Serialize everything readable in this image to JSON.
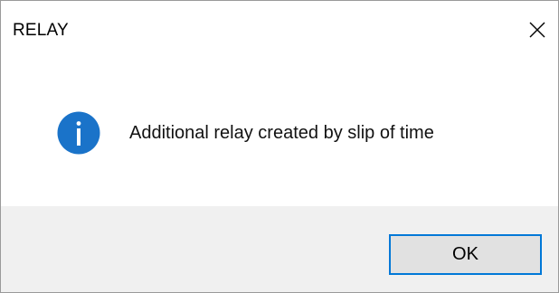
{
  "window": {
    "title": "RELAY",
    "close_icon": "close-icon"
  },
  "content": {
    "icon": "info-icon",
    "icon_color": "#1a73c9",
    "message": "Additional relay created by slip of time"
  },
  "footer": {
    "ok_label": "OK",
    "accent": "#0078d7"
  }
}
